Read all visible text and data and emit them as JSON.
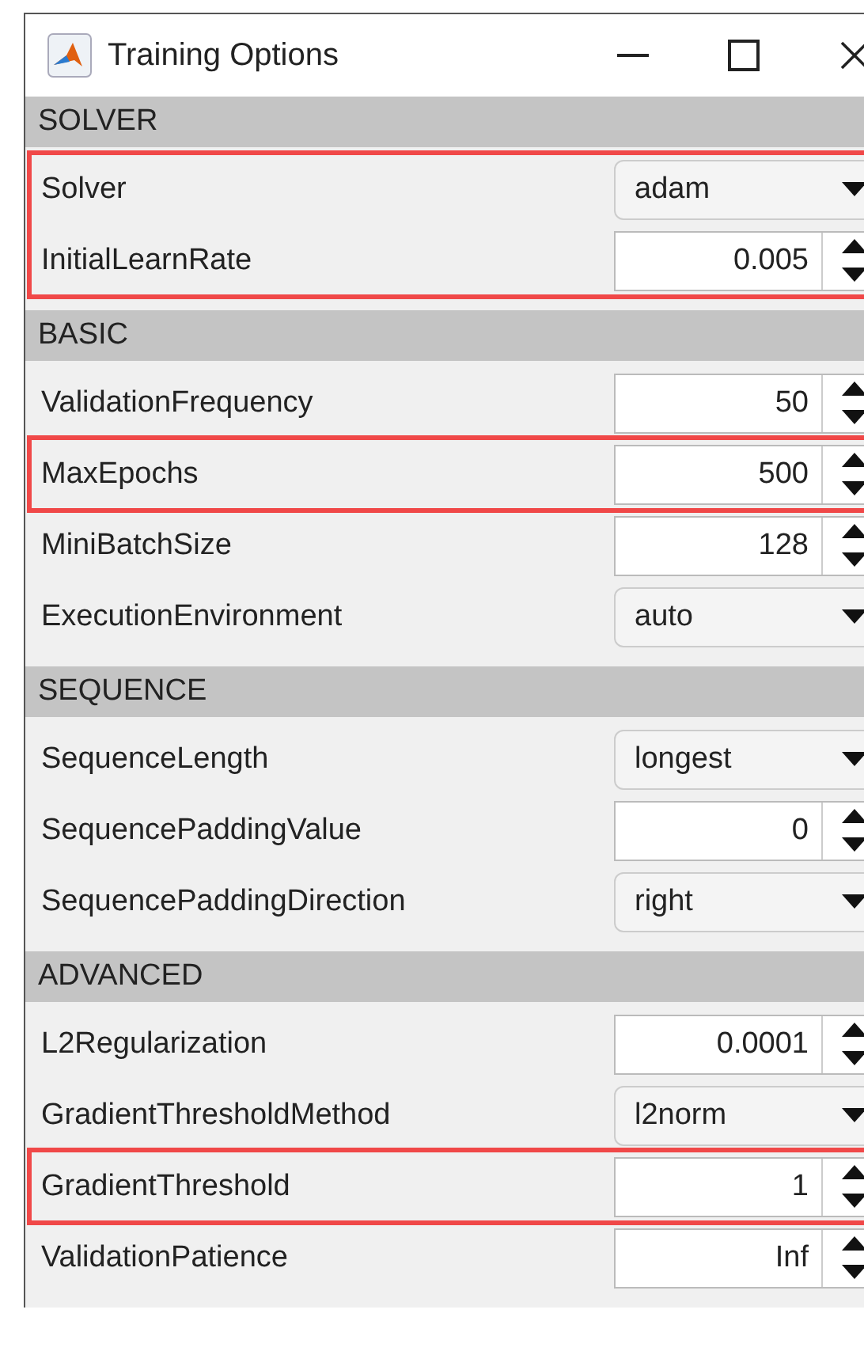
{
  "window": {
    "title": "Training Options"
  },
  "sections": [
    {
      "title": "SOLVER",
      "rows": [
        {
          "label": "Solver",
          "kind": "dropdown",
          "value": "adam",
          "highlighted": true
        },
        {
          "label": "InitialLearnRate",
          "kind": "spinner",
          "value": "0.005",
          "highlighted": true
        }
      ]
    },
    {
      "title": "BASIC",
      "rows": [
        {
          "label": "ValidationFrequency",
          "kind": "spinner",
          "value": "50",
          "highlighted": false
        },
        {
          "label": "MaxEpochs",
          "kind": "spinner",
          "value": "500",
          "highlighted": true
        },
        {
          "label": "MiniBatchSize",
          "kind": "spinner",
          "value": "128",
          "highlighted": false
        },
        {
          "label": "ExecutionEnvironment",
          "kind": "dropdown",
          "value": "auto",
          "highlighted": false
        }
      ]
    },
    {
      "title": "SEQUENCE",
      "rows": [
        {
          "label": "SequenceLength",
          "kind": "dropdown",
          "value": "longest",
          "highlighted": false
        },
        {
          "label": "SequencePaddingValue",
          "kind": "spinner",
          "value": "0",
          "highlighted": false
        },
        {
          "label": "SequencePaddingDirection",
          "kind": "dropdown",
          "value": "right",
          "highlighted": false
        }
      ]
    },
    {
      "title": "ADVANCED",
      "rows": [
        {
          "label": "L2Regularization",
          "kind": "spinner",
          "value": "0.0001",
          "highlighted": false
        },
        {
          "label": "GradientThresholdMethod",
          "kind": "dropdown",
          "value": "l2norm",
          "highlighted": false
        },
        {
          "label": "GradientThreshold",
          "kind": "spinner",
          "value": "1",
          "highlighted": true
        },
        {
          "label": "ValidationPatience",
          "kind": "spinner",
          "value": "Inf",
          "highlighted": false
        }
      ]
    }
  ]
}
